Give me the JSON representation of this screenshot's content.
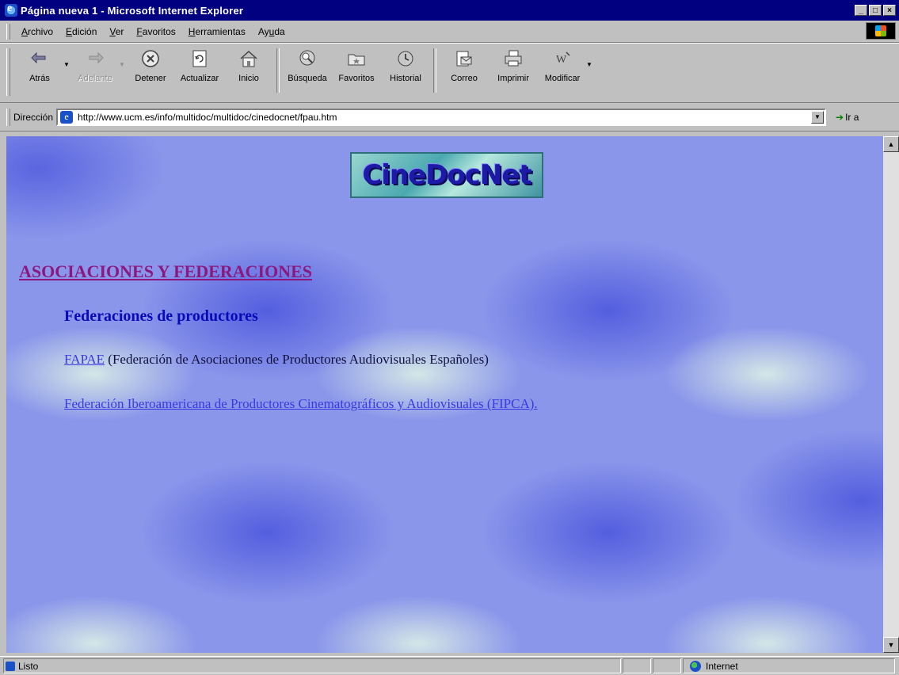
{
  "window": {
    "title": "Página nueva 1 - Microsoft Internet Explorer",
    "controls": [
      "_",
      "□",
      "×"
    ]
  },
  "menu": {
    "items": [
      {
        "pre": "",
        "u": "A",
        "post": "rchivo"
      },
      {
        "pre": "",
        "u": "E",
        "post": "dición"
      },
      {
        "pre": "",
        "u": "V",
        "post": "er"
      },
      {
        "pre": "",
        "u": "F",
        "post": "avoritos"
      },
      {
        "pre": "",
        "u": "H",
        "post": "erramientas"
      },
      {
        "pre": "Ay",
        "u": "u",
        "post": "da"
      }
    ]
  },
  "toolbar": {
    "back": "Atrás",
    "forward": "Adelante",
    "stop": "Detener",
    "refresh": "Actualizar",
    "home": "Inicio",
    "search": "Búsqueda",
    "favorites": "Favoritos",
    "history": "Historial",
    "mail": "Correo",
    "print": "Imprimir",
    "edit": "Modificar"
  },
  "address": {
    "label": "Dirección",
    "url": "http://www.ucm.es/info/multidoc/multidoc/cinedocnet/fpau.htm",
    "go_label": "Ir a"
  },
  "page": {
    "logo_text": "CineDocNet",
    "section_title": "ASOCIACIONES Y FEDERACIONES",
    "subheading": "Federaciones de productores",
    "entry1_link": "FAPAE",
    "entry1_text": " (Federación de Asociaciones de Productores Audiovisuales Españoles)",
    "entry2_link": "Federación Iberoamericana de Productores Cinematográficos y Audiovisuales (FIPCA)."
  },
  "status": {
    "text": "Listo",
    "zone": "Internet"
  },
  "colors": {
    "titlebar": "#000080",
    "section_title": "#8a1880",
    "subheading": "#0a0ab8",
    "link": "#3a3ae0"
  }
}
